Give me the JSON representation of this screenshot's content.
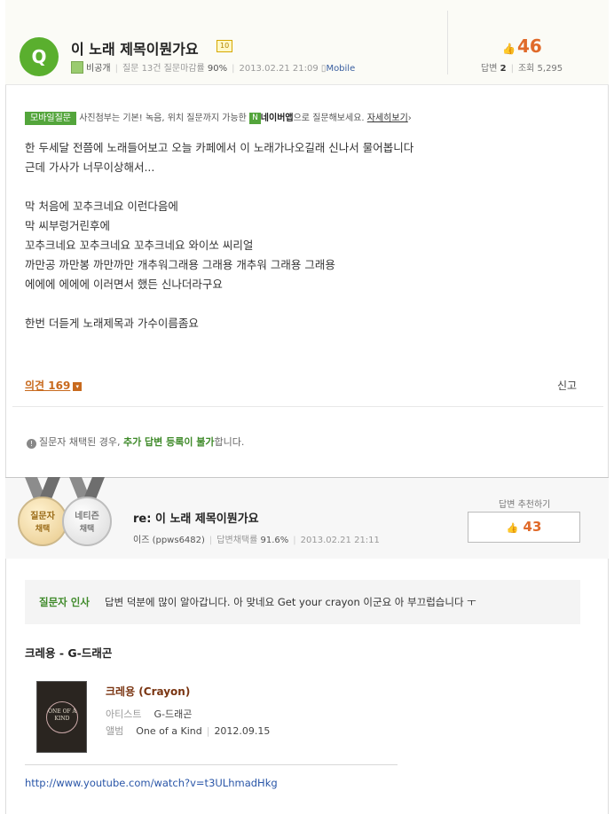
{
  "question": {
    "badge": "Q",
    "title": "이 노래 제목이뭔가요",
    "level": "10",
    "nickname": "비공개",
    "question_stats_label": "질문 13건 질문마감률",
    "close_rate": "90%",
    "datetime": "2013.02.21 21:09",
    "device": "Mobile",
    "score": "46",
    "answers_label": "답변",
    "answers_count": "2",
    "views_label": "조회",
    "views_count": "5,295"
  },
  "mobile_notice": {
    "tag": "모바일질문",
    "text": "사진첨부는 기본! 녹음, 위치 질문까지 가능한",
    "naver_tag": "N",
    "app_text": "네이버앱",
    "suffix": "으로 질문해보세요.",
    "more": "자세히보기"
  },
  "content": "한 두세달 전쯤에 노래들어보고 오늘 카페에서 이 노래가나오길래 신나서 물어봅니다\n근데 가사가 너무이상해서...\n\n막 처음에 꼬추크네요 이런다음에\n막 씨부렁거린후에\n꼬추크네요 꼬추크네요 꼬추크네요 와이쏘 씨리얼\n까만공 까만봉 까만까만 개추워그래용 그래용 개추워 그래용 그래용\n에에에 에에에 이러면서 했든 신나더라구요\n\n한번 더듣게 노래제목과 가수이름좀요",
  "actions": {
    "opinion": "의견 169",
    "report": "신고"
  },
  "notice": {
    "prefix": "질문자 채택된 경우,",
    "emphasis": "추가 답변 등록이 불가",
    "suffix": "합니다."
  },
  "answer": {
    "medal1_line1": "질문자",
    "medal1_line2": "채택",
    "medal2_line1": "네티즌",
    "medal2_line2": "채택",
    "title": "re: 이 노래 제목이뭔가요",
    "nickname": "이즈 (ppws6482)",
    "adopt_label": "답변채택률",
    "adopt_rate": "91.6%",
    "datetime": "2013.02.21 21:11",
    "recommend_label": "답변 추천하기",
    "recommend_count": "43",
    "greeting_label": "질문자 인사",
    "greeting_text": "답변 덕분에 많이 알아갑니다. 아 맞네요 Get your crayon 이군요 아 부끄럽습니다 ㅜ",
    "song_line": "크레용 - G-드래곤",
    "album_cover_text": "ONE OF A KIND",
    "album_title": "크레용 (Crayon)",
    "artist_label": "아티스트",
    "artist": "G-드래곤",
    "album_label": "앨범",
    "album": "One of a Kind",
    "release_date": "2012.09.15",
    "link": "http://www.youtube.com/watch?v=t3ULhmadHkg"
  }
}
